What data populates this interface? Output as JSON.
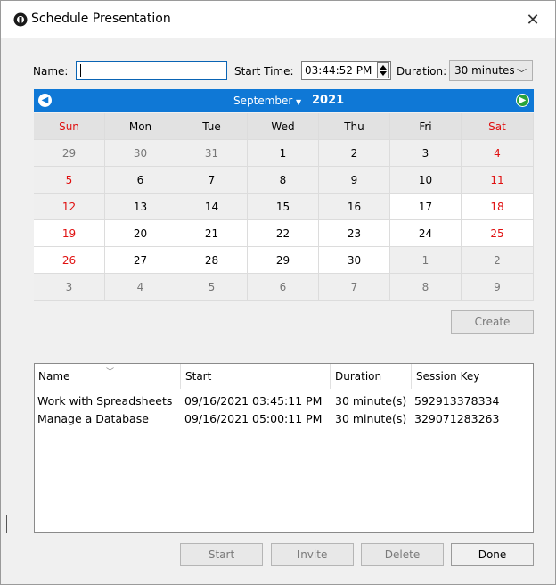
{
  "window": {
    "title": "Schedule Presentation"
  },
  "form": {
    "name_label": "Name:",
    "name_value": "",
    "start_time_label": "Start Time:",
    "start_time_value": "03:44:52 PM",
    "duration_label": "Duration:",
    "duration_value": "30 minutes"
  },
  "calendar": {
    "month": "September",
    "year": "2021",
    "weekdays": [
      "Sun",
      "Mon",
      "Tue",
      "Wed",
      "Thu",
      "Fri",
      "Sat"
    ],
    "weeks": [
      [
        "29",
        "30",
        "31",
        "1",
        "2",
        "3",
        "4"
      ],
      [
        "5",
        "6",
        "7",
        "8",
        "9",
        "10",
        "11"
      ],
      [
        "12",
        "13",
        "14",
        "15",
        "16",
        "17",
        "18"
      ],
      [
        "19",
        "20",
        "21",
        "22",
        "23",
        "24",
        "25"
      ],
      [
        "26",
        "27",
        "28",
        "29",
        "30",
        "1",
        "2"
      ],
      [
        "3",
        "4",
        "5",
        "6",
        "7",
        "8",
        "9"
      ]
    ],
    "colors": {
      "header": "#0f78d6",
      "weekend": "#e01010"
    }
  },
  "create_button": "Create",
  "sessions": {
    "columns": [
      "Name",
      "Start",
      "Duration",
      "Session Key"
    ],
    "rows": [
      [
        "Work with Spreadsheets",
        "09/16/2021 03:45:11 PM",
        "30 minute(s)",
        "592913378334"
      ],
      [
        "Manage a Database",
        "09/16/2021 05:00:11 PM",
        "30 minute(s)",
        "329071283263"
      ]
    ]
  },
  "buttons": {
    "start": "Start",
    "invite": "Invite",
    "delete": "Delete",
    "done": "Done"
  }
}
